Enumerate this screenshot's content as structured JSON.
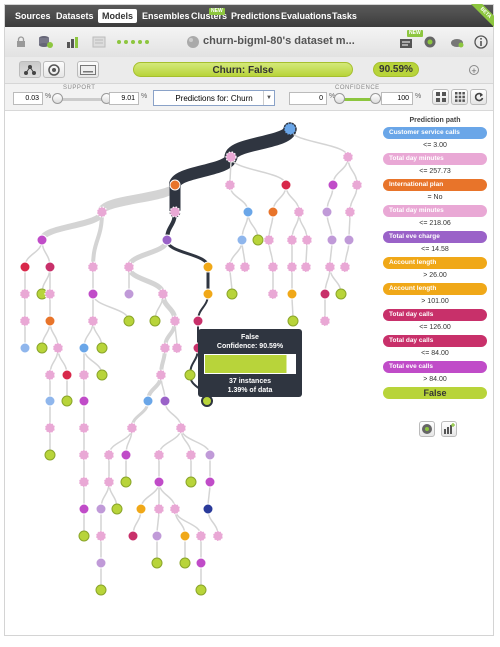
{
  "nav": {
    "items": [
      "Sources",
      "Datasets",
      "Models",
      "Ensembles",
      "Clusters",
      "Predictions",
      "Evaluations",
      "Tasks"
    ],
    "active": "Models",
    "new_badge": "NEW",
    "beta_label": "BETA"
  },
  "toolbar": {
    "title": "churn-bigml-80's dataset m...",
    "new_badge": "NEW"
  },
  "prediction_bar": {
    "label": "Churn: False",
    "confidence": "90.59%"
  },
  "filters": {
    "support_label": "SUPPORT",
    "support_min": "0.03",
    "support_max": "9.01",
    "percent_sign": "%",
    "predictions_for": "Predictions for: Churn",
    "confidence_label": "CONFIDENCE",
    "confidence_min": "0",
    "confidence_max": "100"
  },
  "tooltip": {
    "prediction": "False",
    "confidence": "Confidence: 90.59%",
    "instances": "37 instances",
    "percent_data": "1.39% of data",
    "fill_fraction": 0.9059
  },
  "path": {
    "title": "Prediction path",
    "steps": [
      {
        "field": "Customer service calls",
        "color": "#6aa6e8",
        "value": "<= 3.00"
      },
      {
        "field": "Total day minutes",
        "color": "#e9a8d5",
        "value": "<= 257.73"
      },
      {
        "field": "International plan",
        "color": "#e8742a",
        "value": "= No"
      },
      {
        "field": "Total day minutes",
        "color": "#e9a8d5",
        "value": "<= 218.06"
      },
      {
        "field": "Total eve charge",
        "color": "#9a62c8",
        "value": "<= 14.58"
      },
      {
        "field": "Account length",
        "color": "#f0a818",
        "value": "> 26.00"
      },
      {
        "field": "Account length",
        "color": "#f0a818",
        "value": "> 101.00"
      },
      {
        "field": "Total day calls",
        "color": "#c8306a",
        "value": "<= 126.00"
      },
      {
        "field": "Total day calls",
        "color": "#c8306a",
        "value": "<= 84.00"
      },
      {
        "field": "Total eve calls",
        "color": "#c04cc8",
        "value": "> 84.00"
      }
    ],
    "result": "False"
  },
  "colors": {
    "blue": "#6aa6e8",
    "lightblue": "#8fb6ec",
    "pink": "#e9a8d5",
    "orange": "#e8742a",
    "purple": "#9a62c8",
    "lilac": "#c09ad8",
    "yellow": "#f0a818",
    "crimson": "#c8306a",
    "magenta": "#c04cc8",
    "red": "#d8284a",
    "green": "#b8d43a",
    "navy": "#2a3a9a",
    "path": "#2f3540"
  }
}
